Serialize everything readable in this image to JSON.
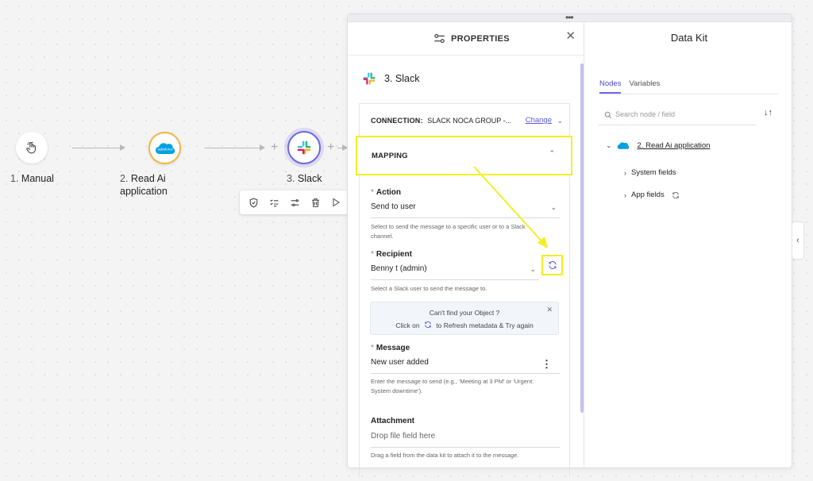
{
  "flow": {
    "nodes": [
      {
        "num": "1.",
        "label": "Manual",
        "icon": "hand-pointer-icon"
      },
      {
        "num": "2.",
        "label": "Read Ai application",
        "icon": "salesforce-icon"
      },
      {
        "num": "3.",
        "label": "Slack",
        "icon": "slack-icon"
      }
    ],
    "toolbar": [
      "shield-check-icon",
      "checklist-icon",
      "sliders-icon",
      "trash-icon",
      "play-icon"
    ]
  },
  "properties": {
    "header_title": "PROPERTIES",
    "node_title": "3. Slack",
    "connection_label": "CONNECTION:",
    "connection_value": "SLACK NOCA GROUP -...",
    "change_label": "Change",
    "mapping_label": "MAPPING",
    "fields": {
      "action": {
        "label": "Action",
        "value": "Send to user",
        "help": "Select to send the message to a specific user or to a Slack channel."
      },
      "recipient": {
        "label": "Recipient",
        "value": "Benny t (admin)",
        "help": "Select a Slack user to send the message to."
      },
      "message": {
        "label": "Message",
        "value": "New user added",
        "help": "Enter the message to send (e.g., 'Meeting at 3 PM' or 'Urgent: System downtime')."
      },
      "attachment": {
        "label": "Attachment",
        "placeholder": "Drop file field here",
        "help": "Drag a field from the data kit to attach it to the message."
      }
    },
    "info_box": {
      "title": "Can't find your Object ?",
      "prefix": "Click on",
      "suffix": "to Refresh metadata & Try again"
    }
  },
  "datakit": {
    "title": "Data Kit",
    "tabs": [
      "Nodes",
      "Variables"
    ],
    "active_tab": "Nodes",
    "search_placeholder": "Search node / field",
    "tree": {
      "root": "2. Read Ai application",
      "children": [
        "System fields",
        "App fields"
      ]
    }
  },
  "colors": {
    "accent": "#5b5bd6",
    "highlight": "#f3ef24",
    "salesforce": "#00a1e0"
  }
}
